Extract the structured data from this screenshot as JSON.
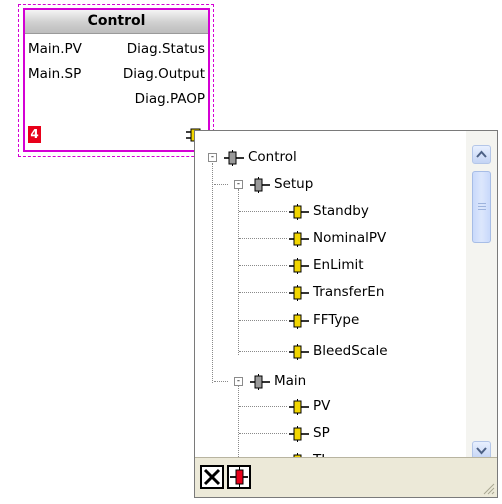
{
  "block": {
    "title": "Control",
    "inputs": [
      "Main.PV",
      "Main.SP"
    ],
    "outputs": [
      "Diag.Status",
      "Diag.Output",
      "Diag.PAOP"
    ],
    "badge": "4",
    "badge_color": "#e8001a",
    "border_color": "#d400d4"
  },
  "tree": {
    "root": {
      "label": "Control",
      "icon": "connector-gray-icon",
      "toggle": "-"
    },
    "groups": [
      {
        "label": "Setup",
        "icon": "connector-gray-icon",
        "toggle": "-",
        "children": [
          "Standby",
          "NominalPV",
          "EnLimit",
          "TransferEn",
          "FFType",
          "BleedScale"
        ]
      },
      {
        "label": "Main",
        "icon": "connector-gray-icon",
        "toggle": "-",
        "children": [
          "PV",
          "SP",
          "TI"
        ]
      }
    ],
    "leaf_icon": "connector-yellow-icon",
    "leaf_color": "#f2d600"
  },
  "toolbar": {
    "close_icon": "close-x-icon",
    "disconnect_icon": "connector-red-icon"
  }
}
